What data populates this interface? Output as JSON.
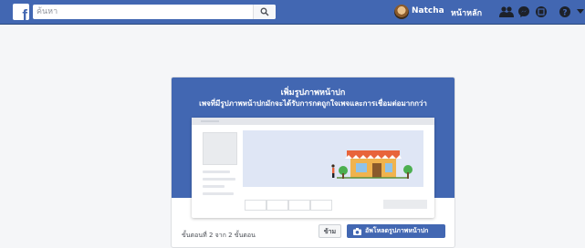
{
  "topbar": {
    "logo": "f",
    "search_placeholder": "ค้นหา",
    "user_name": "Natcha",
    "home_label": "หน้าหลัก",
    "icons": [
      "friend-requests-icon",
      "messenger-icon",
      "notifications-icon",
      "help-icon",
      "account-menu-icon"
    ],
    "brand_color": "#4267b2"
  },
  "card": {
    "title": "เพิ่มรูปภาพหน้าปก",
    "subtitle": "เพจที่มีรูปภาพหน้าปกมักจะได้รับการกดถูกใจเพจและการเชื่อมต่อมากกว่า",
    "step_text": "ขั้นตอนที่ 2 จาก 2 ขั้นตอน",
    "skip_label": "ข้าม",
    "upload_label": "อัพโหลดรูปภาพหน้าปก"
  }
}
